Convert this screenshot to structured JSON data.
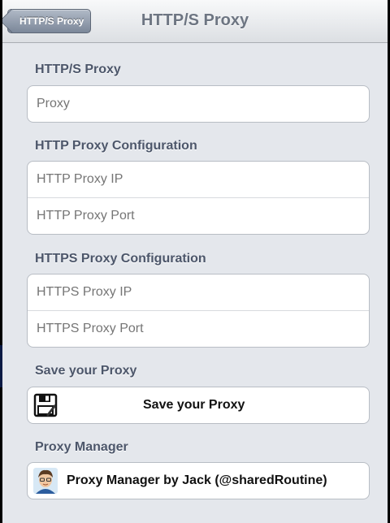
{
  "nav": {
    "back_label": "HTTP/S Proxy",
    "title": "HTTP/S Proxy"
  },
  "sections": {
    "proxy": {
      "label": "HTTP/S Proxy",
      "placeholder": "Proxy"
    },
    "http": {
      "label": "HTTP Proxy Configuration",
      "ip_placeholder": "HTTP Proxy IP",
      "port_placeholder": "HTTP Proxy Port"
    },
    "https": {
      "label": "HTTPS Proxy Configuration",
      "ip_placeholder": "HTTPS Proxy IP",
      "port_placeholder": "HTTPS Proxy Port"
    },
    "save": {
      "label": "Save your Proxy",
      "button_label": "Save your Proxy",
      "icon": "floppy-disk-icon"
    },
    "manager": {
      "label": "Proxy Manager",
      "button_label": "Proxy Manager by Jack (@sharedRoutine)",
      "icon": "avatar-icon"
    }
  },
  "watermark": "",
  "colors": {
    "background": "#e4e7ec",
    "section_label": "#4c566a",
    "placeholder": "#b5b8bd",
    "back_button": "#8e99aa"
  }
}
